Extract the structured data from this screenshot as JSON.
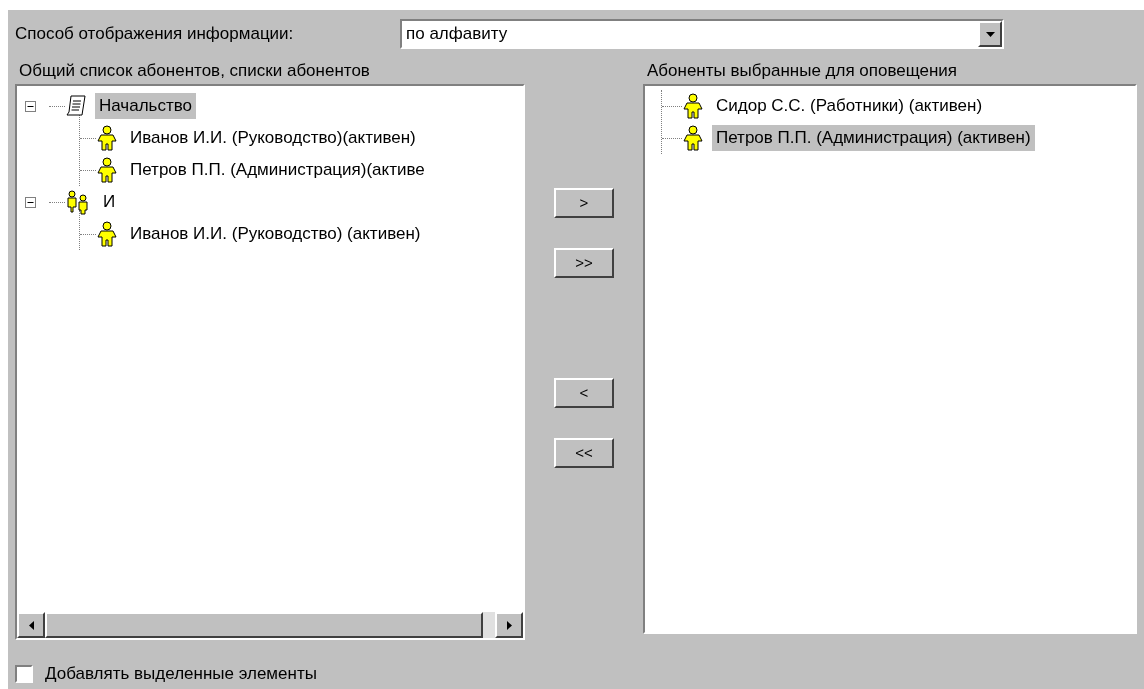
{
  "display_mode": {
    "label": "Способ отображения информации:",
    "value": "по алфавиту"
  },
  "left_panel": {
    "title": "Общий список абонентов, списки абонентов",
    "tree": [
      {
        "kind": "list",
        "label": "Начальство",
        "expanded": true,
        "selected": true,
        "children": [
          {
            "kind": "person",
            "label": "Иванов И.И. (Руководство)(активен)",
            "selected": false
          },
          {
            "kind": "person",
            "label": "Петров П.П. (Администрация)(активе",
            "selected": false
          }
        ]
      },
      {
        "kind": "group",
        "label": "И",
        "expanded": true,
        "selected": false,
        "children": [
          {
            "kind": "person",
            "label": "Иванов И.И. (Руководство) (активен)",
            "selected": false
          }
        ]
      }
    ]
  },
  "transfer_buttons": [
    ">",
    ">>",
    "<",
    "<<"
  ],
  "right_panel": {
    "title": "Абоненты выбранные для оповещения",
    "items": [
      {
        "label": "Сидор С.С. (Работники) (активен)",
        "selected": false
      },
      {
        "label": "Петров П.П. (Администрация) (активен)",
        "selected": true
      }
    ]
  },
  "add_selected": {
    "label": "Добавлять выделенные элементы",
    "checked": false
  }
}
